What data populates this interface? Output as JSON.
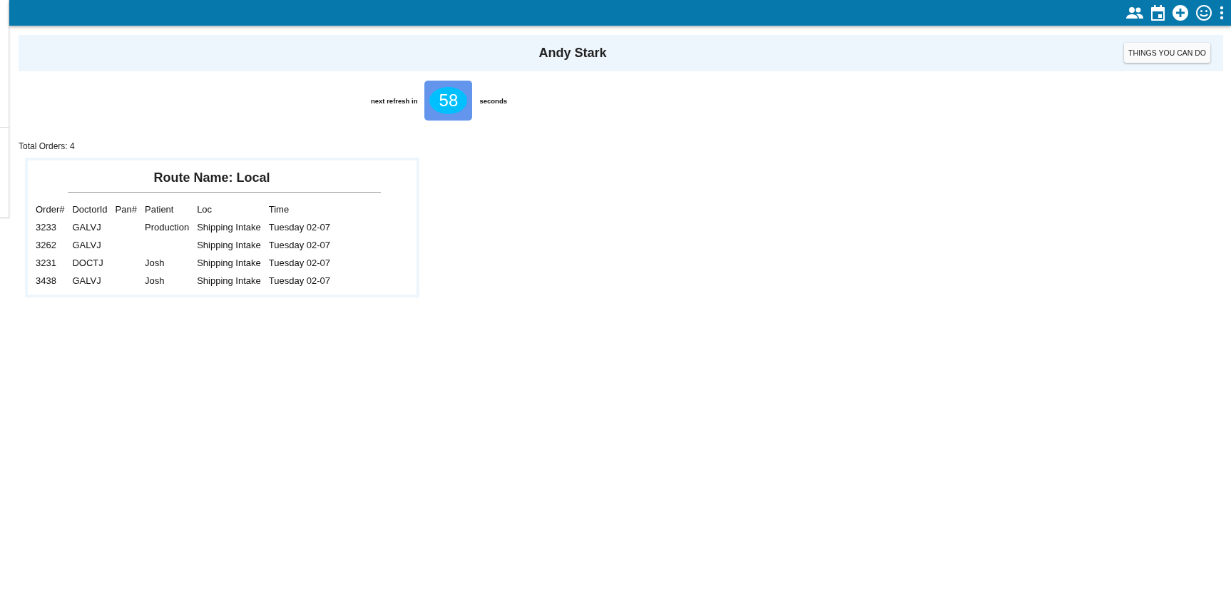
{
  "banner": {
    "user_name": "Andy Stark",
    "button": "THINGS YOU CAN DO"
  },
  "refresh": {
    "prefix": "next refresh in",
    "count": "58",
    "suffix": "seconds"
  },
  "total_orders": "Total Orders: 4",
  "route": {
    "title": "Route Name: Local",
    "columns": [
      "Order#",
      "DoctorId",
      "Pan#",
      "Patient",
      "Loc",
      "Time"
    ],
    "rows": [
      [
        "3233",
        "GALVJ",
        null,
        "Production",
        "Shipping Intake",
        "Tuesday 02-07"
      ],
      [
        "3262",
        "GALVJ",
        null,
        null,
        "Shipping Intake",
        "Tuesday 02-07"
      ],
      [
        "3231",
        "DOCTJ",
        null,
        "Josh",
        "Shipping Intake",
        "Tuesday 02-07"
      ],
      [
        "3438",
        "GALVJ",
        null,
        "Josh",
        "Shipping Intake",
        "Tuesday 02-07"
      ]
    ]
  }
}
